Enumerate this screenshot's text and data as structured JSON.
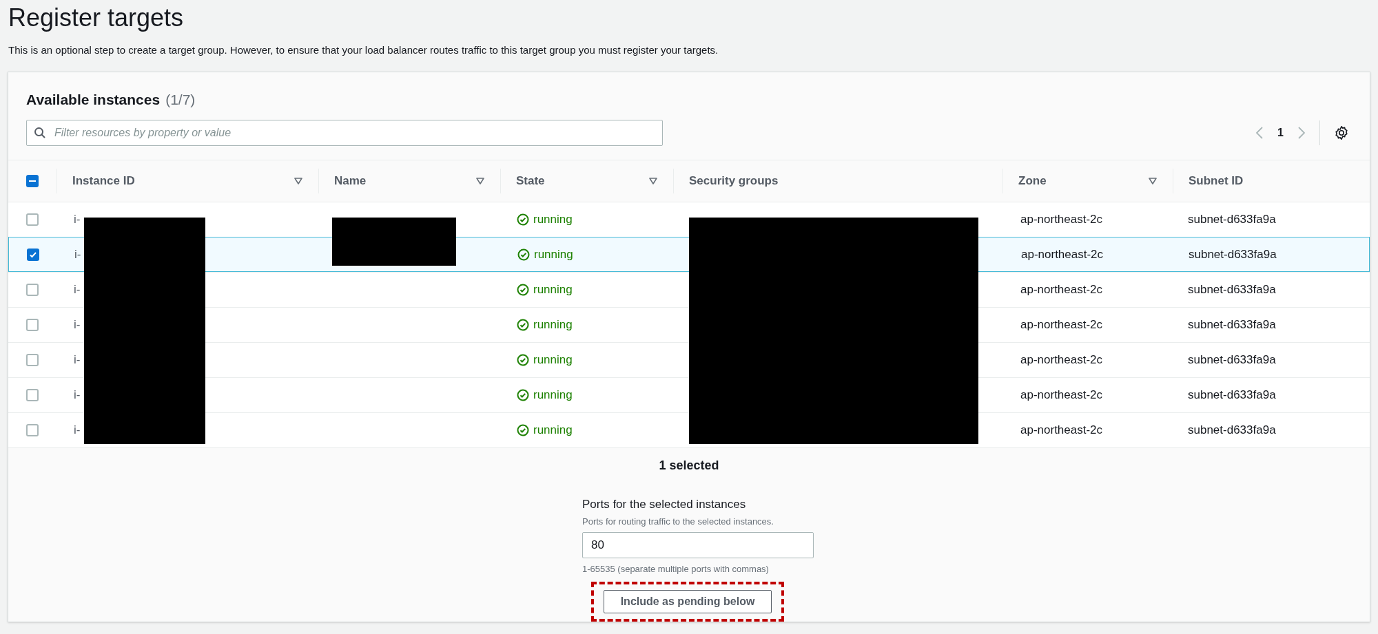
{
  "page": {
    "title": "Register targets",
    "description": "This is an optional step to create a target group. However, to ensure that your load balancer routes traffic to this target group you must register your targets."
  },
  "panel": {
    "title": "Available instances",
    "count": "(1/7)",
    "filter_placeholder": "Filter resources by property or value",
    "page": "1",
    "select_all_indeterminate": true
  },
  "columns": [
    {
      "label": "Instance ID",
      "sortable": true
    },
    {
      "label": "Name",
      "sortable": true
    },
    {
      "label": "State",
      "sortable": true
    },
    {
      "label": "Security groups",
      "sortable": false
    },
    {
      "label": "Zone",
      "sortable": true
    },
    {
      "label": "Subnet ID",
      "sortable": false
    }
  ],
  "rows": [
    {
      "instance_id": "i-",
      "state": "running",
      "zone": "ap-northeast-2c",
      "subnet_id": "subnet-d633fa9a",
      "selected": false
    },
    {
      "instance_id": "i-",
      "state": "running",
      "zone": "ap-northeast-2c",
      "subnet_id": "subnet-d633fa9a",
      "selected": true
    },
    {
      "instance_id": "i-",
      "state": "running",
      "zone": "ap-northeast-2c",
      "subnet_id": "subnet-d633fa9a",
      "selected": false
    },
    {
      "instance_id": "i-",
      "state": "running",
      "zone": "ap-northeast-2c",
      "subnet_id": "subnet-d633fa9a",
      "selected": false
    },
    {
      "instance_id": "i-",
      "state": "running",
      "zone": "ap-northeast-2c",
      "subnet_id": "subnet-d633fa9a",
      "selected": false
    },
    {
      "instance_id": "i-",
      "state": "running",
      "zone": "ap-northeast-2c",
      "subnet_id": "subnet-d633fa9a",
      "selected": false
    },
    {
      "instance_id": "i-",
      "state": "running",
      "zone": "ap-northeast-2c",
      "subnet_id": "subnet-d633fa9a",
      "selected": false
    }
  ],
  "footer": {
    "selected_count": "1 selected",
    "ports_label": "Ports for the selected instances",
    "ports_description": "Ports for routing traffic to the selected instances.",
    "ports_value": "80",
    "ports_hint": "1-65535 (separate multiple ports with commas)",
    "include_button": "Include as pending below",
    "button_highlighted": true
  }
}
